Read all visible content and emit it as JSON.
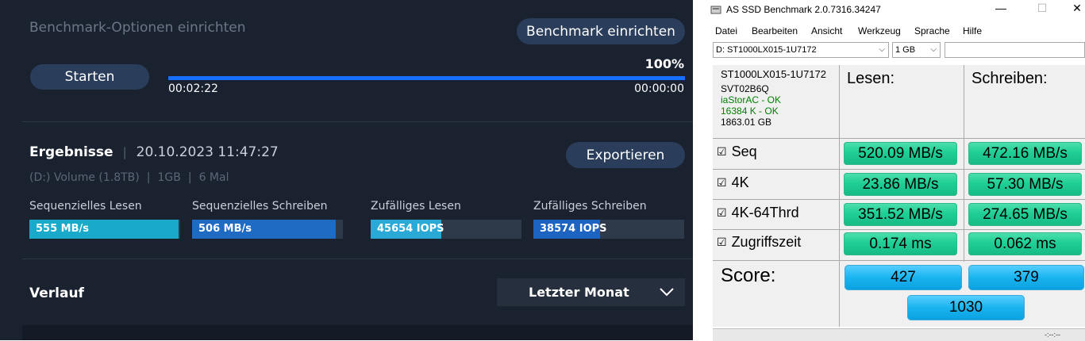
{
  "magician": {
    "section_title": "Benchmark-Optionen einrichten",
    "setup_button": "Benchmark einrichten",
    "start_button": "Starten",
    "progress": {
      "percent_label": "100%",
      "fraction": 1.0,
      "elapsed": "00:02:22",
      "remaining": "00:00:00"
    },
    "results": {
      "heading": "Ergebnisse",
      "separator": "|",
      "timestamp": "20.10.2023 11:47:27",
      "export_button": "Exportieren",
      "meta": {
        "volume": "(D:) Volume (1.8TB)",
        "size": "1GB",
        "runs": "6 Mal",
        "separator": "|"
      },
      "metrics": [
        {
          "label": "Sequenzielles Lesen",
          "value": "555 MB/s",
          "fill": 0.99,
          "color": "#19a9c9"
        },
        {
          "label": "Sequenzielles Schreiben",
          "value": "506 MB/s",
          "fill": 0.95,
          "color": "#1f6bc4"
        },
        {
          "label": "Zufälliges Lesen",
          "value": "45654 IOPS",
          "fill": 0.47,
          "color": "#2aa9d6"
        },
        {
          "label": "Zufälliges Schreiben",
          "value": "38574 IOPS",
          "fill": 0.44,
          "color": "#1d63c2"
        }
      ]
    },
    "history": {
      "label": "Verlauf",
      "dropdown_value": "Letzter Monat"
    }
  },
  "asssd": {
    "title": "AS SSD Benchmark 2.0.7316.34247",
    "window_controls": {
      "minimize": "—",
      "maximize": "☐",
      "close": "✕"
    },
    "menu": [
      "Datei",
      "Bearbeiten",
      "Ansicht",
      "Werkzeug",
      "Sprache",
      "Hilfe"
    ],
    "drive_select": "D: ST1000LX015-1U7172",
    "size_select": "1 GB",
    "drive_info": {
      "model": "ST1000LX015-1U7172",
      "firmware": "SVT02B6Q",
      "driver": "iaStorAC - OK",
      "alignment": "16384 K - OK",
      "capacity": "1863.01 GB"
    },
    "columns": {
      "read": "Lesen:",
      "write": "Schreiben:"
    },
    "rows": [
      {
        "label": "Seq",
        "read": "520.09 MB/s",
        "write": "472.16 MB/s"
      },
      {
        "label": "4K",
        "read": "23.86 MB/s",
        "write": "57.30 MB/s"
      },
      {
        "label": "4K-64Thrd",
        "read": "351.52 MB/s",
        "write": "274.65 MB/s"
      },
      {
        "label": "Zugriffszeit",
        "read": "0.174 ms",
        "write": "0.062 ms"
      }
    ],
    "checkbox_glyph": "☑",
    "score": {
      "label": "Score:",
      "read": "427",
      "write": "379",
      "total": "1030"
    },
    "status_text": "-:--:--",
    "colors": {
      "result_green": "#1fcf95",
      "score_blue": "#19b4f0"
    }
  }
}
